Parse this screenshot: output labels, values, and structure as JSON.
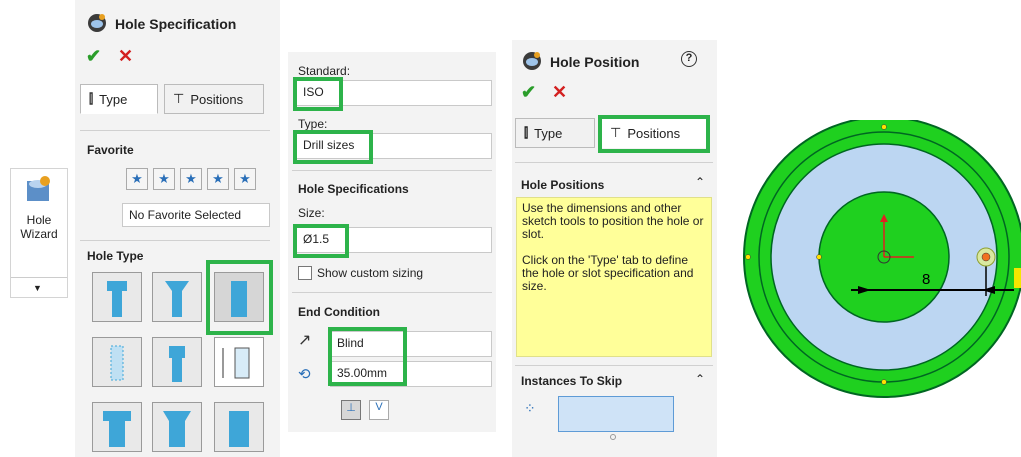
{
  "toolbar": {
    "hole_wizard_label_1": "Hole",
    "hole_wizard_label_2": "Wizard"
  },
  "spec_panel": {
    "title": "Hole Specification",
    "ok_glyph": "✔",
    "cancel_glyph": "✕",
    "tabs": [
      {
        "label": "Type"
      },
      {
        "label": "Positions"
      }
    ],
    "favorite_heading": "Favorite",
    "favorite_value": "No Favorite Selected",
    "hole_type_heading": "Hole Type"
  },
  "options_panel": {
    "standard_label": "Standard:",
    "standard_value": "ISO",
    "type_label": "Type:",
    "type_value": "Drill sizes",
    "hole_spec_heading": "Hole Specifications",
    "size_label": "Size:",
    "size_value": "Ø1.5",
    "custom_sizing_label": "Show custom sizing",
    "end_condition_heading": "End Condition",
    "end_condition_value": "Blind",
    "depth_value": "35.00mm"
  },
  "position_panel": {
    "title": "Hole Position",
    "help_glyph": "?",
    "tabs": [
      {
        "label": "Type"
      },
      {
        "label": "Positions"
      }
    ],
    "hole_positions_heading": "Hole Positions",
    "info_text_1": "Use the dimensions and other sketch tools to position the hole or slot.",
    "info_text_2": "Click on the 'Type' tab to define the hole or slot specification and size.",
    "instances_heading": "Instances To Skip"
  },
  "graphics": {
    "dimension_label": "8"
  },
  "colors": {
    "highlight": "#2db34a",
    "info_bg": "#ffff99",
    "part_green": "#1fd01f",
    "face_blue": "#bcd6f2",
    "ok_green": "#2a9d2a",
    "cancel_red": "#d32020"
  }
}
